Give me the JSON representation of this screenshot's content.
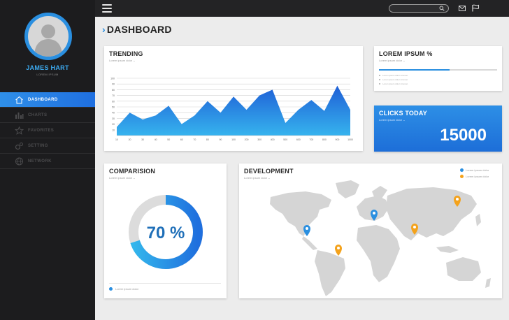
{
  "user": {
    "name": "JAMES HART",
    "role": "LOREM IPSUM"
  },
  "nav": [
    {
      "label": "DASHBOARD",
      "icon": "home-icon"
    },
    {
      "label": "CHARTS",
      "icon": "bar-chart-icon"
    },
    {
      "label": "FAVORITES",
      "icon": "star-icon"
    },
    {
      "label": "SETTING",
      "icon": "gear-icon"
    },
    {
      "label": "NETWORK",
      "icon": "globe-icon"
    }
  ],
  "topbar": {
    "search_placeholder": ""
  },
  "page": {
    "title": "DASHBOARD"
  },
  "trending": {
    "title": "TRENDING",
    "subtitle": "Lorem ipsum dolor ⌄",
    "chart_data": {
      "type": "area",
      "x": [
        "10",
        "20",
        "30",
        "40",
        "50",
        "60",
        "70",
        "80",
        "90",
        "100",
        "200",
        "300",
        "400",
        "500",
        "600",
        "700",
        "800",
        "900",
        "1000"
      ],
      "values": [
        15,
        40,
        28,
        35,
        52,
        20,
        35,
        60,
        40,
        68,
        45,
        70,
        80,
        22,
        45,
        62,
        43,
        87,
        45
      ],
      "yticks": [
        "10",
        "20",
        "30",
        "40",
        "50",
        "60",
        "70",
        "80",
        "90",
        "100"
      ],
      "ylim": [
        0,
        100
      ]
    }
  },
  "lorem_card": {
    "title": "LOREM IPSUM %",
    "subtitle": "Lorem ipsum dolor ⌄",
    "progress": 0.6,
    "items": [
      "Lorem ipsum dolor sit amet",
      "Lorem ipsum dolor sit amet",
      "Lorem ipsum dolor sit amet"
    ]
  },
  "clicks_card": {
    "title": "CLICKS TODAY",
    "subtitle": "Lorem ipsum dolor ⌄",
    "value": "15000"
  },
  "comparison": {
    "title": "COMPARISION",
    "subtitle": "Lorem ipsum dolor ⌄",
    "percent_label": "70 %",
    "chart_data": {
      "type": "pie",
      "values": [
        70,
        30
      ]
    },
    "legend": "Lorem ipsum dolor"
  },
  "development": {
    "title": "DEVELOPMENT",
    "subtitle": "Lorem ipsum dolor ⌄",
    "legend": [
      {
        "label": "Lorem ipsum dolor",
        "color": "#2a8fe0"
      },
      {
        "label": "Lorem ipsum dolor",
        "color": "#f4a21b"
      }
    ]
  },
  "colors": {
    "accent": "#2a8fe0",
    "orange": "#f4a21b",
    "sidebar": "#1c1c1e"
  }
}
